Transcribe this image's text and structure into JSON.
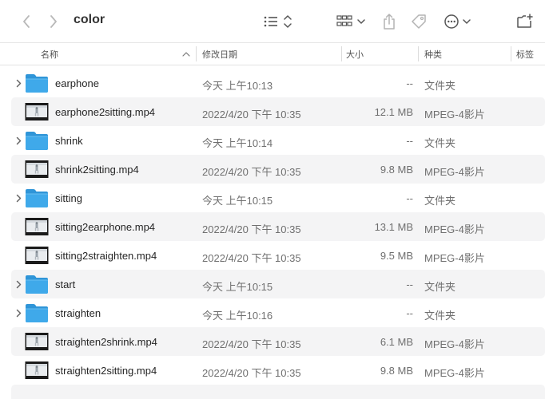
{
  "window": {
    "title": "color"
  },
  "toolbar": {
    "back_icon": "chevron-left-icon",
    "forward_icon": "chevron-right-icon",
    "list_view_icon": "list-view-icon",
    "group_icon": "group-grid-icon",
    "share_icon": "share-icon",
    "tag_icon": "tag-icon",
    "more_icon": "ellipsis-circle-icon",
    "new_folder_icon": "new-folder-icon"
  },
  "columns": {
    "name": "名称",
    "date": "修改日期",
    "size": "大小",
    "kind": "种类",
    "tags": "标签"
  },
  "files": [
    {
      "name": "earphone",
      "date": "今天 上午10:13",
      "size": "--",
      "kind": "文件夹",
      "type": "folder"
    },
    {
      "name": "earphone2sitting.mp4",
      "date": "2022/4/20 下午 10:35",
      "size": "12.1 MB",
      "kind": "MPEG-4影片",
      "type": "video"
    },
    {
      "name": "shrink",
      "date": "今天 上午10:14",
      "size": "--",
      "kind": "文件夹",
      "type": "folder"
    },
    {
      "name": "shrink2sitting.mp4",
      "date": "2022/4/20 下午 10:35",
      "size": "9.8 MB",
      "kind": "MPEG-4影片",
      "type": "video"
    },
    {
      "name": "sitting",
      "date": "今天 上午10:15",
      "size": "--",
      "kind": "文件夹",
      "type": "folder"
    },
    {
      "name": "sitting2earphone.mp4",
      "date": "2022/4/20 下午 10:35",
      "size": "13.1 MB",
      "kind": "MPEG-4影片",
      "type": "video"
    },
    {
      "name": "sitting2straighten.mp4",
      "date": "2022/4/20 下午 10:35",
      "size": "9.5 MB",
      "kind": "MPEG-4影片",
      "type": "video"
    },
    {
      "name": "start",
      "date": "今天 上午10:15",
      "size": "--",
      "kind": "文件夹",
      "type": "folder"
    },
    {
      "name": "straighten",
      "date": "今天 上午10:16",
      "size": "--",
      "kind": "文件夹",
      "type": "folder"
    },
    {
      "name": "straighten2shrink.mp4",
      "date": "2022/4/20 下午 10:35",
      "size": "6.1 MB",
      "kind": "MPEG-4影片",
      "type": "video"
    },
    {
      "name": "straighten2sitting.mp4",
      "date": "2022/4/20 下午 10:35",
      "size": "9.8 MB",
      "kind": "MPEG-4影片",
      "type": "video"
    }
  ],
  "colors": {
    "folder_blue": "#3fa9ea",
    "folder_blue_dark": "#2f95d8",
    "alt_row": "#f4f4f5",
    "text_primary": "#262626",
    "text_secondary": "#6f6f6f"
  }
}
